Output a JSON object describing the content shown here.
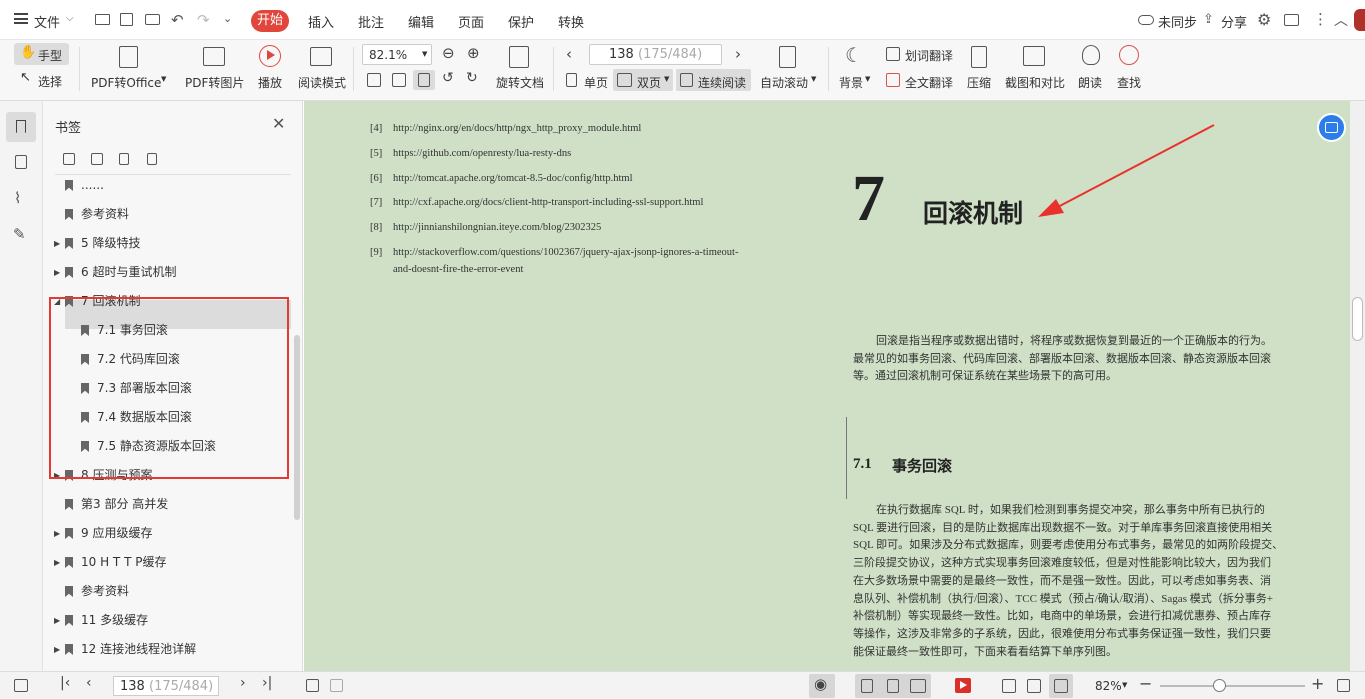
{
  "menu": {
    "file": "文件",
    "start": "开始",
    "insert": "插入",
    "annotate": "批注",
    "edit": "编辑",
    "page": "页面",
    "protect": "保护",
    "convert": "转换",
    "unsync": "未同步",
    "share": "分享"
  },
  "toolbar": {
    "hand": "手型",
    "select": "选择",
    "pdf_to_office": "PDF转Office",
    "pdf_to_image": "PDF转图片",
    "play": "播放",
    "read_mode": "阅读模式",
    "zoom": "82.1%",
    "page_value": "138",
    "page_total": "(175/484)",
    "rotate": "旋转文档",
    "single": "单页",
    "double": "双页",
    "continuous": "连续阅读",
    "auto_scroll": "自动滚动",
    "background": "背景",
    "word_translate": "划词翻译",
    "full_translate": "全文翻译",
    "compress": "压缩",
    "screenshot_compare": "截图和对比",
    "read_aloud": "朗读",
    "find": "查找"
  },
  "panel": {
    "title": "书签"
  },
  "bookmarks": [
    {
      "label": "......",
      "arrow": ""
    },
    {
      "label": "参考资料",
      "arrow": ""
    },
    {
      "label": "5 降级特技",
      "arrow": "▶"
    },
    {
      "label": "6 超时与重试机制",
      "arrow": "▶"
    },
    {
      "label": "7 回滚机制",
      "arrow": "◢"
    },
    {
      "label": "7.1 事务回滚",
      "arrow": ""
    },
    {
      "label": "7.2 代码库回滚",
      "arrow": ""
    },
    {
      "label": "7.3 部署版本回滚",
      "arrow": ""
    },
    {
      "label": "7.4 数据版本回滚",
      "arrow": ""
    },
    {
      "label": "7.5 静态资源版本回滚",
      "arrow": ""
    },
    {
      "label": "8 压测与预案",
      "arrow": "▶"
    },
    {
      "label": "第3 部分 高并发",
      "arrow": ""
    },
    {
      "label": "9 应用级缓存",
      "arrow": "▶"
    },
    {
      "label": "10 H T T P缓存",
      "arrow": "▶"
    },
    {
      "label": "参考资料",
      "arrow": ""
    },
    {
      "label": "11 多级缓存",
      "arrow": "▶"
    },
    {
      "label": "12 连接池线程池详解",
      "arrow": "▶"
    }
  ],
  "refs": [
    {
      "num": "[4]",
      "text": "http://nginx.org/en/docs/http/ngx_http_proxy_module.html"
    },
    {
      "num": "[5]",
      "text": "https://github.com/openresty/lua-resty-dns"
    },
    {
      "num": "[6]",
      "text": "http://tomcat.apache.org/tomcat-8.5-doc/config/http.html"
    },
    {
      "num": "[7]",
      "text": "http://cxf.apache.org/docs/client-http-transport-including-ssl-support.html"
    },
    {
      "num": "[8]",
      "text": "http://jinnianshilongnian.iteye.com/blog/2302325"
    },
    {
      "num": "[9]",
      "text": "http://stackoverflow.com/questions/1002367/jquery-ajax-jsonp-ignores-a-timeout-",
      "cont": "and-doesnt-fire-the-error-event"
    }
  ],
  "chapter": {
    "num": "7",
    "title": "回滚机制"
  },
  "intro": [
    "回滚是指当程序或数据出错时，将程序或数据恢复到最近的一个正确版本的行为。",
    "最常见的如事务回滚、代码库回滚、部署版本回滚、数据版本回滚、静态资源版本回滚",
    "等。通过回滚机制可保证系统在某些场景下的高可用。"
  ],
  "section": {
    "num": "7.1",
    "title": "事务回滚"
  },
  "section_body": [
    "在执行数据库 SQL 时，如果我们检测到事务提交冲突，那么事务中所有已执行的",
    "SQL 要进行回滚，目的是防止数据库出现数据不一致。对于单库事务回滚直接使用相关",
    "SQL 即可。如果涉及分布式数据库，则要考虑使用分布式事务，最常见的如两阶段提交、",
    "三阶段提交协议，这种方式实现事务回滚难度较低，但是对性能影响比较大，因为我们",
    "在大多数场景中需要的是最终一致性，而不是强一致性。因此，可以考虑如事务表、消",
    "息队列、补偿机制（执行/回滚）、TCC 模式（预占/确认/取消）、Sagas 模式（拆分事务+",
    "补偿机制）等实现最终一致性。比如，电商中的单场景，会进行扣减优惠券、预占库存",
    "等操作，这涉及非常多的子系统，因此，很难使用分布式事务保证强一致性，我们只要",
    "能保证最终一致性即可，下面来看看结算下单序列图。"
  ],
  "status": {
    "page_value": "138",
    "page_total": "(175/484)",
    "zoom": "82%"
  },
  "colors": {
    "accent": "#e0463c",
    "doc_bg": "#cfe0c6",
    "highlight": "#e53935",
    "arrow": "#e8322b"
  }
}
